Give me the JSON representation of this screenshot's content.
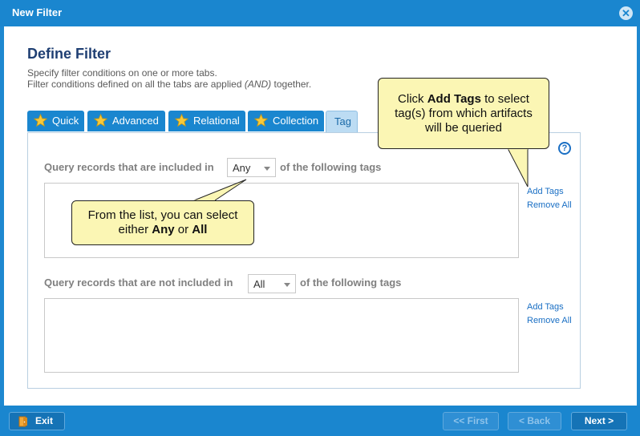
{
  "window": {
    "title": "New Filter",
    "close_icon": "close-icon"
  },
  "page": {
    "heading": "Define Filter",
    "desc_line1": "Specify filter conditions on one or more tabs.",
    "desc_line2_prefix": "Filter conditions defined on all the tabs are applied ",
    "desc_line2_em": "(AND)",
    "desc_line2_suffix": " together."
  },
  "tabs": [
    {
      "label": "Quick",
      "icon": "star-icon"
    },
    {
      "label": "Advanced",
      "icon": "star-icon"
    },
    {
      "label": "Relational",
      "icon": "star-icon"
    },
    {
      "label": "Collection",
      "icon": "star-icon"
    },
    {
      "label": "Tag",
      "active": true
    }
  ],
  "included": {
    "label_before": "Query records that are included in",
    "select_value": "Any",
    "label_after": "of the following tags",
    "add_tags": "Add Tags",
    "remove_all": "Remove All"
  },
  "excluded": {
    "label_before": "Query records that are not included in",
    "select_value": "All",
    "label_after": "of the following tags",
    "add_tags": "Add Tags",
    "remove_all": "Remove All"
  },
  "help": {
    "label": "?",
    "icon": "help-icon"
  },
  "callouts": {
    "addtags_prefix": "Click ",
    "addtags_bold": "Add Tags",
    "addtags_line1_suffix": " to select",
    "addtags_line2": "tag(s) from which artifacts",
    "addtags_line3": "will be queried",
    "list_line1": "From the list, you can select",
    "list_line2_prefix": "either ",
    "list_bold1": "Any",
    "list_mid": " or ",
    "list_bold2": "All"
  },
  "footer": {
    "exit": "Exit",
    "exit_icon": "exit-door-icon",
    "first": "<< First",
    "back": "< Back",
    "next": "Next >"
  },
  "colors": {
    "accent": "#1a86cf",
    "heading": "#1f3f73",
    "callout_bg": "#fbf6b4",
    "link": "#1a6fc4"
  }
}
